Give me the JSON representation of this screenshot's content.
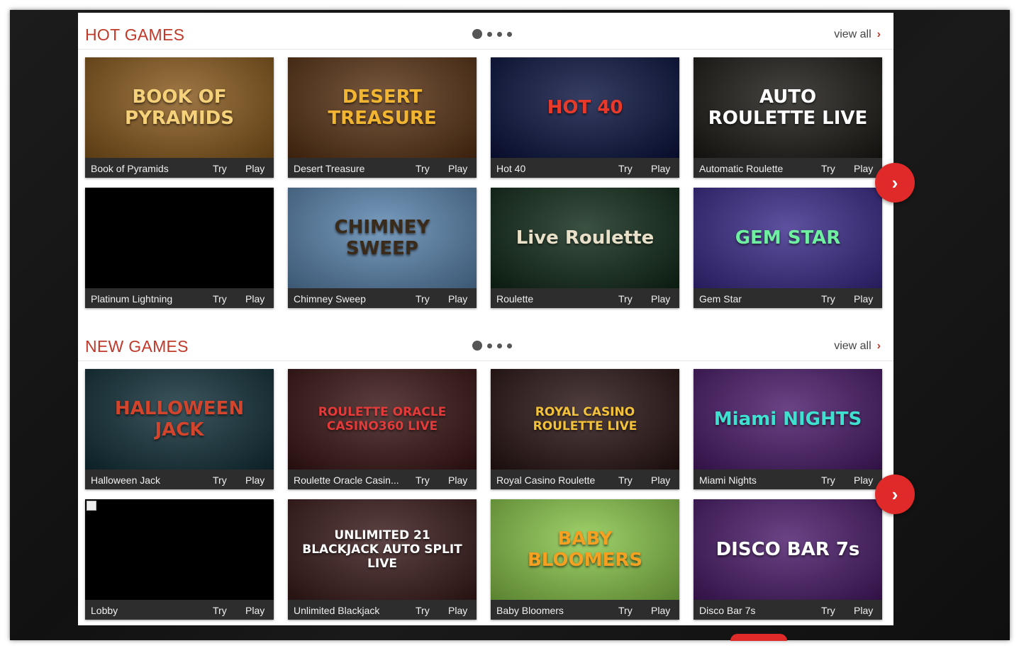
{
  "hot_games": {
    "title": "HOT GAMES",
    "view_all": "view all",
    "games": [
      {
        "name": "Book of Pyramids",
        "art": "BOOK OF PYRAMIDS",
        "try": "Try",
        "play": "Play",
        "bg": "#8a5a1c",
        "fg": "#f5d27a"
      },
      {
        "name": "Desert Treasure",
        "art": "DESERT TREASURE",
        "try": "Try",
        "play": "Play",
        "bg": "#5a3314",
        "fg": "#f2b531"
      },
      {
        "name": "Hot 40",
        "art": "HOT 40",
        "try": "Try",
        "play": "Play",
        "bg": "#0a1340",
        "fg": "#e83a2a"
      },
      {
        "name": "Automatic Roulette",
        "art": "AUTO ROULETTE LIVE",
        "try": "Try",
        "play": "Play",
        "bg": "#1d1a16",
        "fg": "#ffffff"
      },
      {
        "name": "Platinum Lightning",
        "art": "",
        "try": "Try",
        "play": "Play",
        "bg": "#000000",
        "fg": "#ffffff"
      },
      {
        "name": "Chimney Sweep",
        "art": "CHIMNEY SWEEP",
        "try": "Try",
        "play": "Play",
        "bg": "#5b86b0",
        "fg": "#3a2a1a"
      },
      {
        "name": "Roulette",
        "art": "Live Roulette",
        "try": "Try",
        "play": "Play",
        "bg": "#0f2a18",
        "fg": "#e8e0c8"
      },
      {
        "name": "Gem Star",
        "art": "GEM STAR",
        "try": "Try",
        "play": "Play",
        "bg": "#3a2a8a",
        "fg": "#6ef0a0"
      }
    ]
  },
  "new_games": {
    "title": "NEW GAMES",
    "view_all": "view all",
    "games": [
      {
        "name": "Halloween Jack",
        "art": "HALLOWEEN JACK",
        "try": "Try",
        "play": "Play",
        "bg": "#12303a",
        "fg": "#d2452c"
      },
      {
        "name": "Roulette Oracle Casin...",
        "art": "ROULETTE ORACLE CASINO360 LIVE",
        "try": "Try",
        "play": "Play",
        "bg": "#3a1414",
        "fg": "#e43a3a"
      },
      {
        "name": "Royal Casino Roulette",
        "art": "ROYAL CASINO ROULETTE LIVE",
        "try": "Try",
        "play": "Play",
        "bg": "#2a1414",
        "fg": "#f3c23a"
      },
      {
        "name": "Miami Nights",
        "art": "Miami NIGHTS",
        "try": "Try",
        "play": "Play",
        "bg": "#4a1a6a",
        "fg": "#3ee0d0"
      },
      {
        "name": "Lobby",
        "art": "",
        "try": "Try",
        "play": "Play",
        "bg": "#000000",
        "fg": "#ffffff"
      },
      {
        "name": "Unlimited Blackjack",
        "art": "UNLIMITED 21 BLACKJACK AUTO SPLIT LIVE",
        "try": "Try",
        "play": "Play",
        "bg": "#3a1a1a",
        "fg": "#ffffff"
      },
      {
        "name": "Baby Bloomers",
        "art": "BABY BLOOMERS",
        "try": "Try",
        "play": "Play",
        "bg": "#8ac84a",
        "fg": "#f5a020"
      },
      {
        "name": "Disco Bar 7s",
        "art": "DISCO BAR 7s",
        "try": "Try",
        "play": "Play",
        "bg": "#4a1a6a",
        "fg": "#ffffff"
      }
    ]
  },
  "icons": {
    "next": "chevron-right-icon",
    "view_all_chevron": "chevron-right-icon"
  },
  "colors": {
    "accent": "#c0392b",
    "button": "#e02a2a",
    "card_bar": "#2d2d2d"
  }
}
